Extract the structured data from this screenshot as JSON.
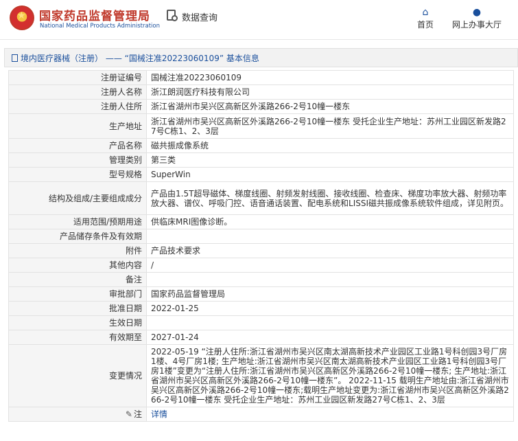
{
  "header": {
    "org_name_cn": "国家药品监督管理局",
    "org_name_en": "National Medical Products Administration",
    "search_title": "数据查询",
    "nav": [
      {
        "label": "首页",
        "icon": "home-icon"
      },
      {
        "label": "网上办事大厅",
        "icon": "person-icon"
      }
    ]
  },
  "breadcrumb": "境内医疗器械（注册） —— “国械注准20223060109” 基本信息",
  "record": [
    {
      "key": "注册证编号",
      "value": "国械注准20223060109"
    },
    {
      "key": "注册人名称",
      "value": "浙江朗润医疗科技有限公司"
    },
    {
      "key": "注册人住所",
      "value": "浙江省湖州市吴兴区高新区外溪路266-2号10幢一楼东"
    },
    {
      "key": "生产地址",
      "value": "浙江省湖州市吴兴区高新区外溪路266-2号10幢一楼东 受托企业生产地址：苏州工业园区新发路27号C栋1、2、3层"
    },
    {
      "key": "产品名称",
      "value": "磁共振成像系统"
    },
    {
      "key": "管理类别",
      "value": "第三类"
    },
    {
      "key": "型号规格",
      "value": "SuperWin"
    },
    {
      "key": "结构及组成/主要组成成分",
      "value": "产品由1.5T超导磁体、梯度线圈、射频发射线圈、接收线圈、检查床、梯度功率放大器、射频功率放大器、谱仪、呼吸门控、语音通话装置、配电系统和LISSI磁共振成像系统软件组成，详见附页。"
    },
    {
      "key": "适用范围/预期用途",
      "value": "供临床MRI图像诊断。"
    },
    {
      "key": "产品储存条件及有效期",
      "value": ""
    },
    {
      "key": "附件",
      "value": "产品技术要求"
    },
    {
      "key": "其他内容",
      "value": "/"
    },
    {
      "key": "备注",
      "value": ""
    },
    {
      "key": "审批部门",
      "value": "国家药品监督管理局"
    },
    {
      "key": "批准日期",
      "value": "2022-01-25"
    },
    {
      "key": "生效日期",
      "value": ""
    },
    {
      "key": "有效期至",
      "value": "2027-01-24"
    },
    {
      "key": "变更情况",
      "value": "2022-05-19 “注册人住所:浙江省湖州市吴兴区南太湖高新技术产业园区工业路1号科创园3号厂房1楼、4号厂房1楼; 生产地址:浙江省湖州市吴兴区南太湖高新技术产业园区工业路1号科创园3号厂房1楼”变更为“注册人住所:浙江省湖州市吴兴区高新区外溪路266-2号10幢一楼东; 生产地址:浙江省湖州市吴兴区高新区外溪路266-2号10幢一楼东”。\n2022-11-15 载明生产地址由:浙江省湖州市吴兴区高新区外溪路266-2号10幢一楼东;载明生产地址变更为:浙江省湖州市吴兴区高新区外溪路266-2号10幢一楼东\n受托企业生产地址：苏州工业园区新发路27号C栋1、2、3层"
    }
  ],
  "note_row": {
    "key": "注",
    "link": "详情"
  }
}
